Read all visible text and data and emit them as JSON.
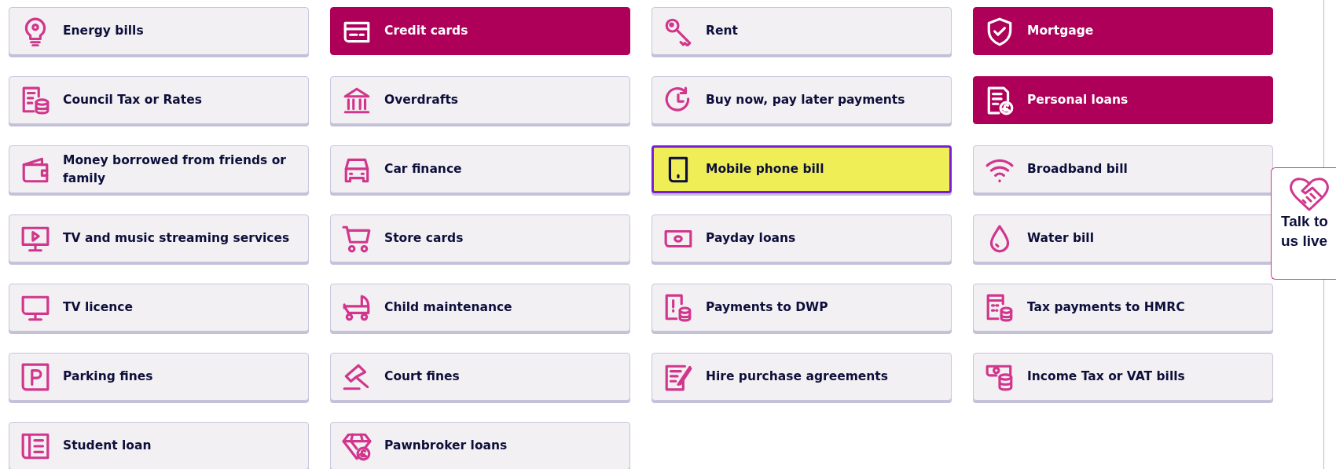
{
  "cards": [
    {
      "label": "Energy bills",
      "selected": false,
      "focused": false
    },
    {
      "label": "Credit cards",
      "selected": true,
      "focused": false
    },
    {
      "label": "Rent",
      "selected": false,
      "focused": false
    },
    {
      "label": "Mortgage",
      "selected": true,
      "focused": false
    },
    {
      "label": "Council Tax or Rates",
      "selected": false,
      "focused": false
    },
    {
      "label": "Overdrafts",
      "selected": false,
      "focused": false
    },
    {
      "label": "Buy now, pay later payments",
      "selected": false,
      "focused": false
    },
    {
      "label": "Personal loans",
      "selected": true,
      "focused": false
    },
    {
      "label": "Money borrowed from friends or family",
      "selected": false,
      "focused": false
    },
    {
      "label": "Car finance",
      "selected": false,
      "focused": false
    },
    {
      "label": "Mobile phone bill",
      "selected": false,
      "focused": true
    },
    {
      "label": "Broadband bill",
      "selected": false,
      "focused": false
    },
    {
      "label": "TV and music streaming services",
      "selected": false,
      "focused": false
    },
    {
      "label": "Store cards",
      "selected": false,
      "focused": false
    },
    {
      "label": "Payday loans",
      "selected": false,
      "focused": false
    },
    {
      "label": "Water bill",
      "selected": false,
      "focused": false
    },
    {
      "label": "TV licence",
      "selected": false,
      "focused": false
    },
    {
      "label": "Child maintenance",
      "selected": false,
      "focused": false
    },
    {
      "label": "Payments to DWP",
      "selected": false,
      "focused": false
    },
    {
      "label": "Tax payments to HMRC",
      "selected": false,
      "focused": false
    },
    {
      "label": "Parking fines",
      "selected": false,
      "focused": false
    },
    {
      "label": "Court fines",
      "selected": false,
      "focused": false
    },
    {
      "label": "Hire purchase agreements",
      "selected": false,
      "focused": false
    },
    {
      "label": "Income Tax or VAT bills",
      "selected": false,
      "focused": false
    },
    {
      "label": "Student loan",
      "selected": false,
      "focused": false
    },
    {
      "label": "Pawnbroker loans",
      "selected": false,
      "focused": false
    }
  ],
  "chat_widget": {
    "label": "Talk to us live"
  }
}
